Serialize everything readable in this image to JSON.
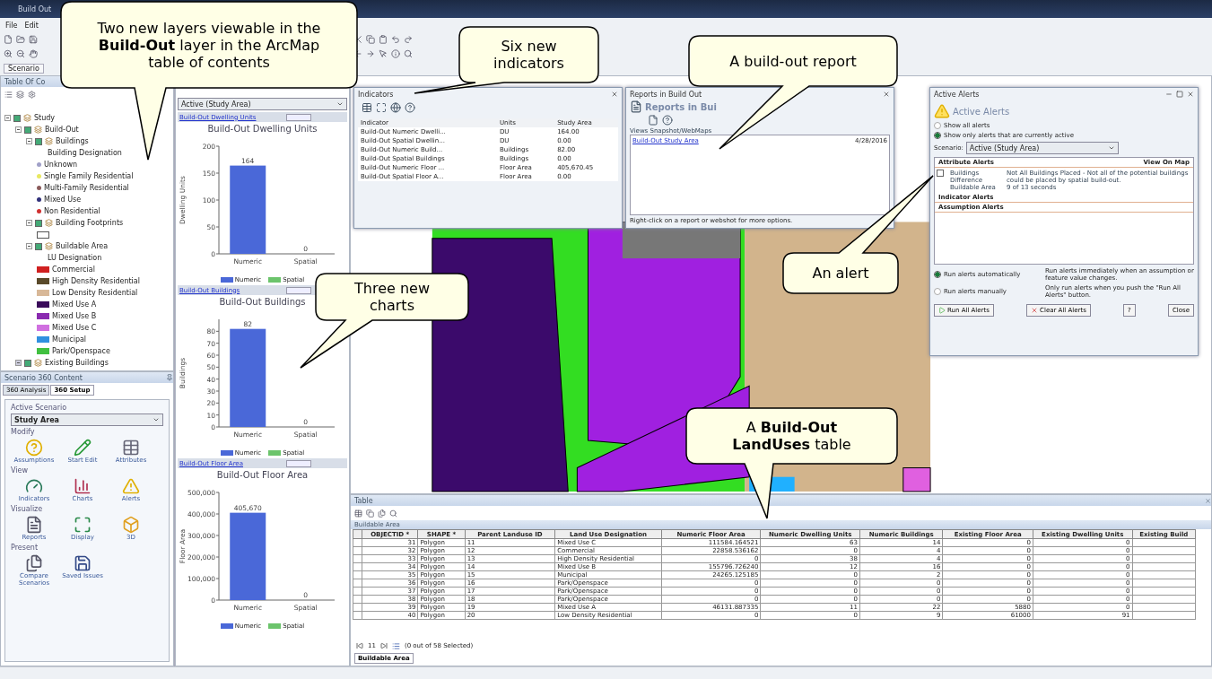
{
  "window": {
    "title": "Build Out"
  },
  "menu": [
    "File",
    "Edit"
  ],
  "scenario_tab": "Scenario",
  "toc": {
    "title": "Table Of Co",
    "tree": [
      {
        "kind": "layer",
        "label": "Study",
        "checked": true,
        "expanded": true,
        "children": [
          {
            "kind": "layer",
            "label": "Build-Out",
            "checked": true,
            "expanded": true,
            "children": [
              {
                "kind": "layer",
                "label": "Buildings",
                "checked": true,
                "expanded": true,
                "children": [
                  {
                    "kind": "heading",
                    "label": "Building Designation"
                  },
                  {
                    "kind": "point",
                    "label": "Unknown",
                    "color": "#a0a0c8"
                  },
                  {
                    "kind": "point",
                    "label": "Single Family Residential",
                    "color": "#e8e860"
                  },
                  {
                    "kind": "point",
                    "label": "Multi-Family Residential",
                    "color": "#8a5a5a"
                  },
                  {
                    "kind": "point",
                    "label": "Mixed Use",
                    "color": "#30307a"
                  },
                  {
                    "kind": "point",
                    "label": "Non Residential",
                    "color": "#d03030"
                  }
                ]
              },
              {
                "kind": "layer",
                "label": "Building Footprints",
                "checked": true,
                "expanded": true,
                "children": [
                  {
                    "kind": "outline"
                  }
                ]
              },
              {
                "kind": "layer",
                "label": "Buildable Area",
                "checked": true,
                "expanded": true,
                "children": [
                  {
                    "kind": "heading",
                    "label": "LU Designation"
                  },
                  {
                    "kind": "fill",
                    "label": "Commercial",
                    "color": "#d02020"
                  },
                  {
                    "kind": "fill",
                    "label": "High Density Residential",
                    "color": "#5a4a2a"
                  },
                  {
                    "kind": "fill",
                    "label": "Low Density Residential",
                    "color": "#d8b898"
                  },
                  {
                    "kind": "fill",
                    "label": "Mixed Use A",
                    "color": "#3a0a5a"
                  },
                  {
                    "kind": "fill",
                    "label": "Mixed Use B",
                    "color": "#8a2ab0"
                  },
                  {
                    "kind": "fill",
                    "label": "Mixed Use C",
                    "color": "#d070e0"
                  },
                  {
                    "kind": "fill",
                    "label": "Municipal",
                    "color": "#3090e0"
                  },
                  {
                    "kind": "fill",
                    "label": "Park/Openspace",
                    "color": "#40c040"
                  }
                ]
              }
            ]
          },
          {
            "kind": "layer",
            "label": "Existing Buildings",
            "checked": true,
            "expanded": false
          }
        ]
      }
    ]
  },
  "scenario_panel": {
    "title": "Scenario 360 Content",
    "tabs": [
      {
        "label": "360 Analysis",
        "selected": false
      },
      {
        "label": "360 Setup",
        "selected": true
      }
    ],
    "active_label": "Active Scenario",
    "active_scenario": "Study Area",
    "sections": [
      {
        "title": "Modify",
        "tools": [
          "Assumptions",
          "Start Edit",
          "Attributes"
        ]
      },
      {
        "title": "View",
        "tools": [
          "Indicators",
          "Charts",
          "Alerts"
        ]
      },
      {
        "title": "Visualize",
        "tools": [
          "Reports",
          "Display",
          "3D"
        ]
      },
      {
        "title": "Present",
        "tools": [
          "Compare Scenarios",
          "Saved Issues"
        ]
      }
    ]
  },
  "charts_panel": {
    "scenario": "Active (Study Area)",
    "charts": [
      {
        "header": "Build-Out Dwelling Units",
        "chart_data": {
          "type": "bar",
          "title": "Build-Out Dwelling Units",
          "ylabel": "Dwelling Units",
          "categories": [
            "Numeric",
            "Spatial"
          ],
          "series": [
            {
              "name": "Numeric",
              "color": "#4a68d8",
              "values": [
                164,
                null
              ]
            },
            {
              "name": "Spatial",
              "color": "#6cc46c",
              "values": [
                null,
                0
              ]
            }
          ],
          "ylim": [
            0,
            200
          ],
          "yticks": [
            0,
            50,
            100,
            150,
            200
          ],
          "data_labels": true
        }
      },
      {
        "header": "Build-Out Buildings",
        "chart_data": {
          "type": "bar",
          "title": "Build-Out Buildings",
          "ylabel": "Buildings",
          "categories": [
            "Numeric",
            "Spatial"
          ],
          "series": [
            {
              "name": "Numeric",
              "color": "#4a68d8",
              "values": [
                82,
                null
              ]
            },
            {
              "name": "Spatial",
              "color": "#6cc46c",
              "values": [
                null,
                0
              ]
            }
          ],
          "ylim": [
            0,
            90
          ],
          "yticks": [
            0,
            10,
            20,
            30,
            40,
            50,
            60,
            70,
            80
          ],
          "data_labels": true
        }
      },
      {
        "header": "Build-Out Floor Area",
        "chart_data": {
          "type": "bar",
          "title": "Build-Out Floor Area",
          "ylabel": "Floor Area",
          "categories": [
            "Numeric",
            "Spatial"
          ],
          "series": [
            {
              "name": "Numeric",
              "color": "#4a68d8",
              "values": [
                405670,
                null
              ]
            },
            {
              "name": "Spatial",
              "color": "#6cc46c",
              "values": [
                null,
                0
              ]
            }
          ],
          "ylim": [
            0,
            500000
          ],
          "yticks": [
            0,
            {
              "value": 100000,
              "label": "100,000"
            },
            {
              "value": 200000,
              "label": "200,000"
            },
            {
              "value": 300000,
              "label": "300,000"
            },
            {
              "value": 400000,
              "label": "400,000"
            },
            {
              "value": 500000,
              "label": "500,000"
            }
          ],
          "value_labels": [
            [
              "405,670",
              null
            ],
            [
              null,
              "0"
            ]
          ]
        }
      }
    ]
  },
  "indicators": {
    "title": "Indicators",
    "columns": [
      "Indicator",
      "Units",
      "Study Area"
    ],
    "rows": [
      [
        "Build-Out Numeric Dwelli...",
        "DU",
        "164.00"
      ],
      [
        "Build-Out Spatial Dwellin...",
        "DU",
        "0.00"
      ],
      [
        "Build-Out Numeric Build...",
        "Buildings",
        "82.00"
      ],
      [
        "Build-Out Spatial Buildings",
        "Buildings",
        "0.00"
      ],
      [
        "Build-Out Numeric Floor ...",
        "Floor Area",
        "405,670.45"
      ],
      [
        "Build-Out Spatial Floor A...",
        "Floor Area",
        "0.00"
      ]
    ]
  },
  "reports": {
    "title": "Reports in Build Out",
    "heading": "Reports in Bui",
    "list_label": "Views Snapshot/WebMaps",
    "items": [
      {
        "name": "Build-Out Study Area",
        "date": "4/28/2016"
      }
    ],
    "hint": "Right-click on a report or webshot for more options."
  },
  "alerts": {
    "title": "Active Alerts",
    "heading": "Active Alerts",
    "filters": [
      {
        "label": "Show all alerts",
        "selected": false
      },
      {
        "label": "Show only alerts that are currently active",
        "selected": true
      }
    ],
    "scenario_label": "Scenario:",
    "scenario": "Active (Study Area)",
    "groups": [
      {
        "title": "Attribute Alerts",
        "action": "View On Map",
        "alerts": [
          {
            "name": "Buildings Difference Buildable Area",
            "checked": false,
            "message": "Not All Buildings Placed - Not all of the potential buildings could be placed by spatial build-out.",
            "timing": "9 of 13 seconds"
          }
        ]
      },
      {
        "title": "Indicator Alerts"
      },
      {
        "title": "Assumption Alerts"
      }
    ],
    "modes": [
      {
        "label": "Run alerts automatically",
        "description": "Run alerts immediately when an assumption or feature value changes.",
        "selected": true
      },
      {
        "label": "Run alerts manually",
        "description": "Only run alerts when you push the \"Run All Alerts\" button.",
        "selected": false
      }
    ],
    "buttons": [
      {
        "kind": "run",
        "label": "Run All Alerts"
      },
      {
        "kind": "clear",
        "label": "Clear All Alerts"
      },
      {
        "kind": "help",
        "label": "?"
      },
      {
        "kind": "close",
        "label": "Close"
      }
    ]
  },
  "table": {
    "title": "Table",
    "layer": "Buildable Area",
    "columns": [
      "OBJECTID *",
      "SHAPE *",
      "Parent Landuse ID",
      "Land Use Designation",
      "Numeric Floor Area",
      "Numeric Dwelling Units",
      "Numeric Buildings",
      "Existing Floor Area",
      "Existing Dwelling Units",
      "Existing Build"
    ],
    "rows": [
      [
        "31",
        "Polygon",
        "11",
        "Mixed Use C",
        "111584.164521",
        "63",
        "14",
        "0",
        "0"
      ],
      [
        "32",
        "Polygon",
        "12",
        "Commercial",
        "22858.536162",
        "0",
        "4",
        "0",
        "0"
      ],
      [
        "33",
        "Polygon",
        "13",
        "High Density Residential",
        "0",
        "38",
        "4",
        "0",
        "0"
      ],
      [
        "34",
        "Polygon",
        "14",
        "Mixed Use B",
        "155796.726240",
        "12",
        "16",
        "0",
        "0"
      ],
      [
        "35",
        "Polygon",
        "15",
        "Municipal",
        "24265.125185",
        "0",
        "2",
        "0",
        "0"
      ],
      [
        "36",
        "Polygon",
        "16",
        "Park/Openspace",
        "0",
        "0",
        "0",
        "0",
        "0"
      ],
      [
        "37",
        "Polygon",
        "17",
        "Park/Openspace",
        "0",
        "0",
        "0",
        "0",
        "0"
      ],
      [
        "38",
        "Polygon",
        "18",
        "Park/Openspace",
        "0",
        "0",
        "0",
        "0",
        "0"
      ],
      [
        "39",
        "Polygon",
        "19",
        "Mixed Use A",
        "46131.887335",
        "11",
        "22",
        "5880",
        "0"
      ],
      [
        "40",
        "Polygon",
        "20",
        "Low Density Residential",
        "0",
        "0",
        "9",
        "61000",
        "91"
      ]
    ],
    "record": "11",
    "selection": "(0 out of 58 Selected)",
    "bottom_tab": "Buildable Area"
  },
  "callouts": [
    "Two new layers viewable in the **Build-Out** layer in the ArcMap table of contents",
    "Six new indicators",
    "A build-out report",
    "An alert",
    "Three new charts",
    "A **Build-Out LandUses** table"
  ]
}
